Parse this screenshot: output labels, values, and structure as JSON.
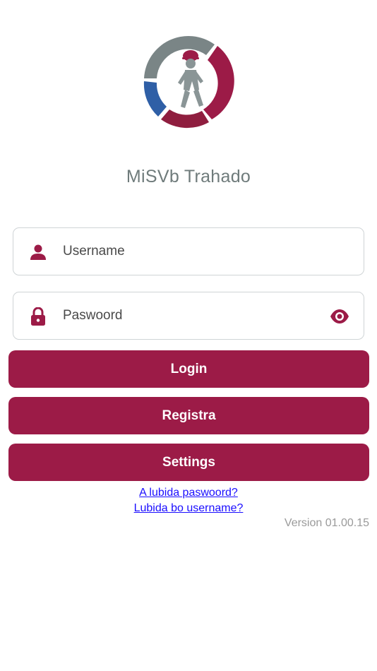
{
  "app": {
    "title": "MiSVb Trahado",
    "logo_icon": "worker-helmet-logo-icon"
  },
  "form": {
    "username_placeholder": "Username",
    "username_value": "",
    "password_placeholder": "Paswoord",
    "password_value": "",
    "username_icon": "person-icon",
    "password_icon": "lock-icon",
    "toggle_icon": "eye-icon"
  },
  "buttons": {
    "login": "Login",
    "register": "Registra",
    "settings": "Settings"
  },
  "links": {
    "forgot_password": "A lubida paswoord?",
    "forgot_username": "Lubida bo username?"
  },
  "footer": {
    "version": "Version 01.00.15"
  },
  "colors": {
    "primary": "#9c1b47",
    "logo_gray": "#7a8586",
    "logo_blue": "#2f5fa6",
    "logo_red": "#8f1e3f",
    "link": "#1a0dff"
  }
}
